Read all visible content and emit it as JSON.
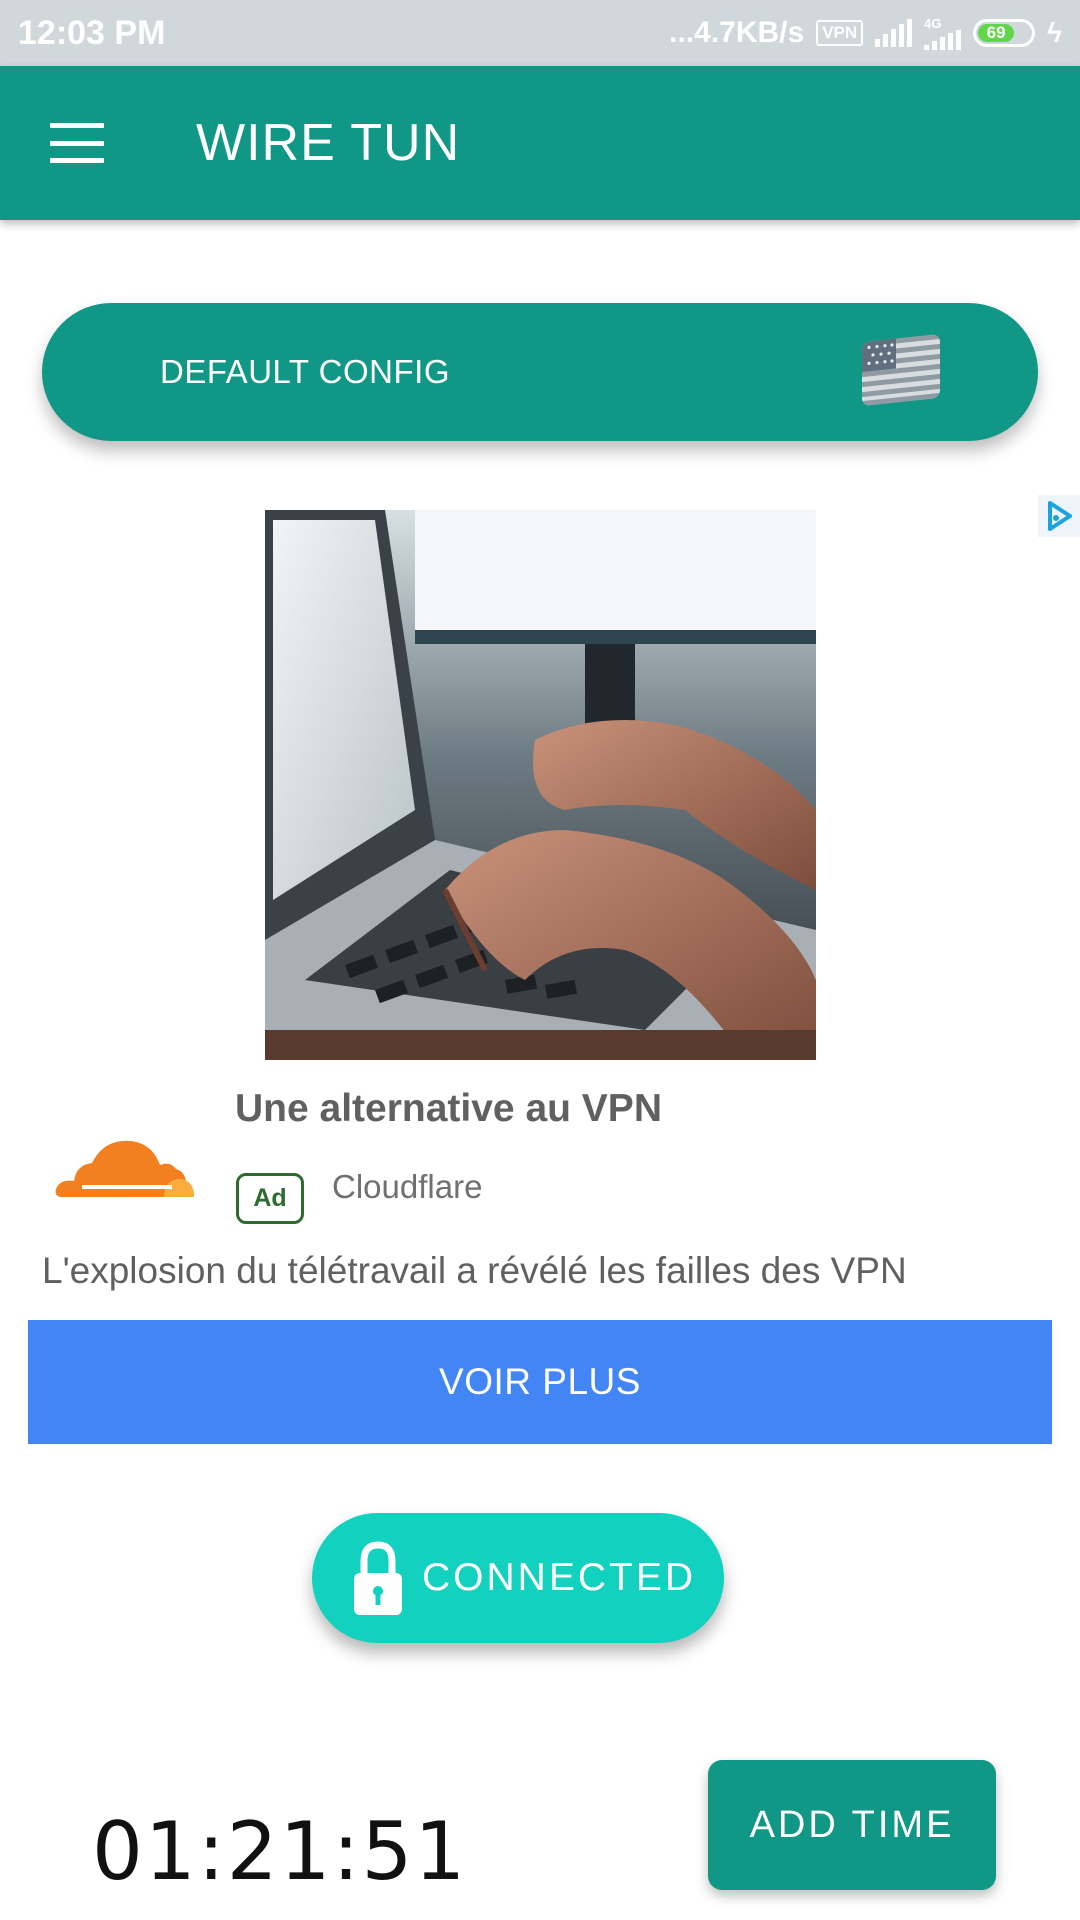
{
  "status_bar": {
    "time": "12:03 PM",
    "network_speed": "...4.7KB/s",
    "vpn_badge": "VPN",
    "network_type": "4G",
    "battery_level": "69",
    "icons": [
      "vpn-icon",
      "signal-icon",
      "4g-signal-icon",
      "battery-icon",
      "charging-icon"
    ]
  },
  "app_bar": {
    "title": "WIRE TUN",
    "menu_icon": "menu-icon"
  },
  "config": {
    "label": "DEFAULT CONFIG",
    "flag_icon": "us-flag-icon"
  },
  "ad": {
    "choices_icon": "ad-choices-icon",
    "image": "laptop-typing-photo",
    "headline": "Une alternative au VPN",
    "badge": "Ad",
    "advertiser": "Cloudflare",
    "logo_icon": "cloudflare-cloud-icon",
    "body": "L'explosion du télétravail a révélé les failles des VPN",
    "cta_label": "VOIR PLUS"
  },
  "connection": {
    "status_label": "CONNECTED",
    "lock_icon": "lock-icon"
  },
  "timer": {
    "value": "01:21:51"
  },
  "add_time": {
    "label": "ADD TIME"
  },
  "colors": {
    "primary": "#119786",
    "connected": "#12d2bf",
    "ad_cta": "#4285f4",
    "cloud_orange": "#f38020",
    "status_bar": "#d0d8dc"
  }
}
